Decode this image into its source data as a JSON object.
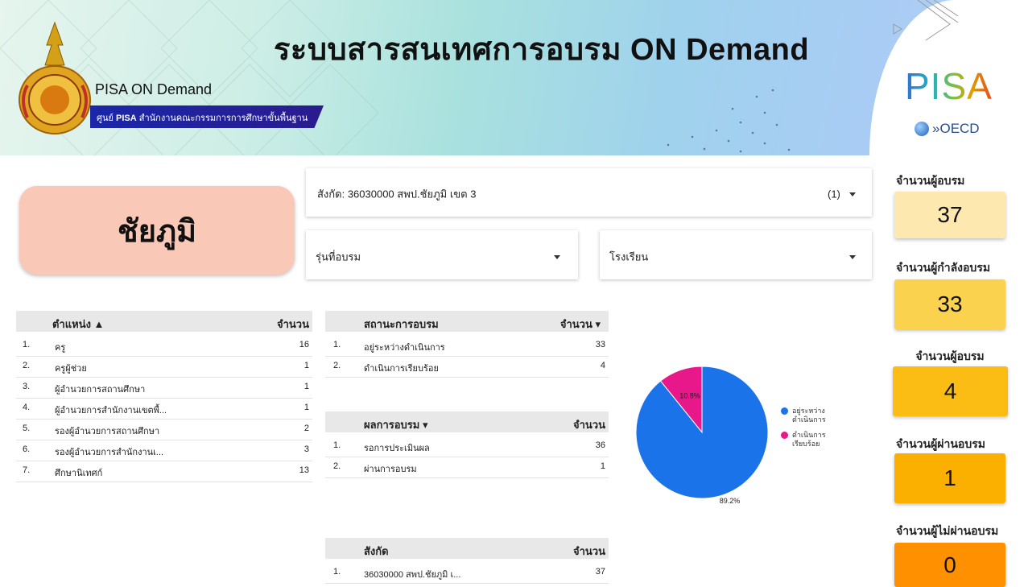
{
  "header": {
    "title": "ระบบสารสนเทศการอบรม ON Demand",
    "brand": "PISA ON Demand",
    "subtitle_prefix": "ศูนย์",
    "subtitle_bold": "PISA",
    "subtitle_rest": "สำนักงานคณะกรรมการการศึกษาขั้นพื้นฐาน",
    "pisa_logo": "PISA",
    "oecd": "OECD"
  },
  "province": "ชัยภูมิ",
  "filters": {
    "affiliation": "สังกัด: 36030000 สพป.ชัยภูมิ เขต 3",
    "affiliation_count": "(1)",
    "batch": "รุ่นที่อบรม",
    "school": "โรงเรียน"
  },
  "position_table": {
    "header_col1": "ตำแหน่ง ▲",
    "header_col2": "จำนวน",
    "rows": [
      {
        "no": "1.",
        "name": "ครู",
        "count": "16"
      },
      {
        "no": "2.",
        "name": "ครูผู้ช่วย",
        "count": "1"
      },
      {
        "no": "3.",
        "name": "ผู้อำนวยการสถานศึกษา",
        "count": "1"
      },
      {
        "no": "4.",
        "name": "ผู้อำนวยการสำนักงานเขตพื้...",
        "count": "1"
      },
      {
        "no": "5.",
        "name": "รองผู้อำนวยการสถานศึกษา",
        "count": "2"
      },
      {
        "no": "6.",
        "name": "รองผู้อำนวยการสำนักงานเ...",
        "count": "3"
      },
      {
        "no": "7.",
        "name": "ศึกษานิเทศก์",
        "count": "13"
      }
    ]
  },
  "status_table": {
    "header_col1": "สถานะการอบรม",
    "header_col2": "จำนวน ▾",
    "rows": [
      {
        "no": "1.",
        "name": "อยู่ระหว่างดำเนินการ",
        "count": "33"
      },
      {
        "no": "2.",
        "name": "ดำเนินการเรียบร้อย",
        "count": "4"
      }
    ]
  },
  "result_table": {
    "header_col1": "ผลการอบรม ▾",
    "header_col2": "จำนวน",
    "rows": [
      {
        "no": "1.",
        "name": "รอการประเมินผล",
        "count": "36"
      },
      {
        "no": "2.",
        "name": "ผ่านการอบรม",
        "count": "1"
      }
    ]
  },
  "affiliation_table": {
    "header_col1": "สังกัด",
    "header_col2": "จำนวน",
    "rows": [
      {
        "no": "1.",
        "name": "36030000 สพป.ชัยภูมิ เ...",
        "count": "37"
      }
    ]
  },
  "chart_data": {
    "type": "pie",
    "slices": [
      {
        "label": "อยู่ระหว่างดำเนินการ",
        "value": 89.2,
        "display": "89.2%",
        "color": "#1a73e8"
      },
      {
        "label": "ดำเนินการเรียบร้อย",
        "value": 10.8,
        "display": "10.8%",
        "color": "#e8178a"
      }
    ],
    "legend": [
      "อยู่ระหว่าง ดำเนินการ",
      "ดำเนินการ เรียบร้อย"
    ],
    "legend_position": "right"
  },
  "kpis": [
    {
      "label": "จำนวนผู้อบรม",
      "value": "37",
      "color": "#fde9b0"
    },
    {
      "label": "จำนวนผู้กำลังอบรม",
      "value": "33",
      "color": "#fbd24e"
    },
    {
      "label": "จำนวนผู้อบรม",
      "value": "4",
      "color": "#fbbd13"
    },
    {
      "label": "จำนวนผู้ผ่านอบรม",
      "value": "1",
      "color": "#fbb000"
    },
    {
      "label": "จำนวนผู้ไม่ผ่านอบรม",
      "value": "0",
      "color": "#ff9100"
    }
  ]
}
